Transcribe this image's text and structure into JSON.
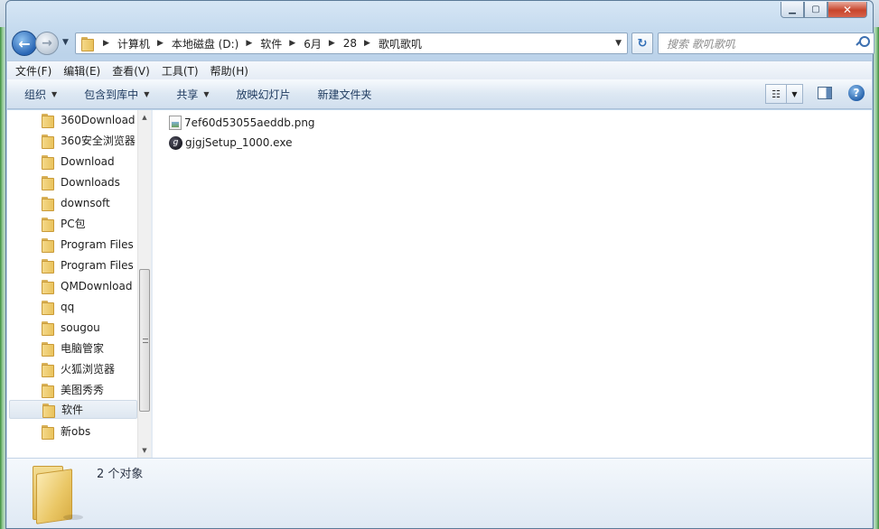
{
  "window": {
    "caption": {
      "minimize": "▁",
      "maximize": "▢",
      "close": "✕"
    }
  },
  "nav": {
    "back_icon": "arrow-left-icon",
    "forward_icon": "arrow-right-icon",
    "breadcrumbs": [
      "计算机",
      "本地磁盘 (D:)",
      "软件",
      "6月",
      "28",
      "歌叽歌叽"
    ],
    "search_placeholder": "搜索 歌叽歌叽"
  },
  "menubar": [
    "文件(F)",
    "编辑(E)",
    "查看(V)",
    "工具(T)",
    "帮助(H)"
  ],
  "commandbar": {
    "organize": "组织",
    "include_in_library": "包含到库中",
    "share": "共享",
    "slideshow": "放映幻灯片",
    "new_folder": "新建文件夹"
  },
  "tree": [
    {
      "label": "360Download",
      "selected": false
    },
    {
      "label": "360安全浏览器",
      "selected": false
    },
    {
      "label": "Download",
      "selected": false
    },
    {
      "label": "Downloads",
      "selected": false
    },
    {
      "label": "downsoft",
      "selected": false
    },
    {
      "label": "PC包",
      "selected": false
    },
    {
      "label": "Program Files",
      "selected": false
    },
    {
      "label": "Program Files",
      "selected": false
    },
    {
      "label": "QMDownload",
      "selected": false
    },
    {
      "label": "qq",
      "selected": false
    },
    {
      "label": "sougou",
      "selected": false
    },
    {
      "label": "电脑管家",
      "selected": false
    },
    {
      "label": "火狐浏览器",
      "selected": false
    },
    {
      "label": "美图秀秀",
      "selected": false
    },
    {
      "label": "软件",
      "selected": true
    },
    {
      "label": "新obs",
      "selected": false
    }
  ],
  "files": [
    {
      "name": "7ef60d53055aeddb.png",
      "icon": "png-file-icon"
    },
    {
      "name": "gjgjSetup_1000.exe",
      "icon": "exe-file-icon"
    }
  ],
  "details": {
    "count_text": "2 个对象"
  }
}
